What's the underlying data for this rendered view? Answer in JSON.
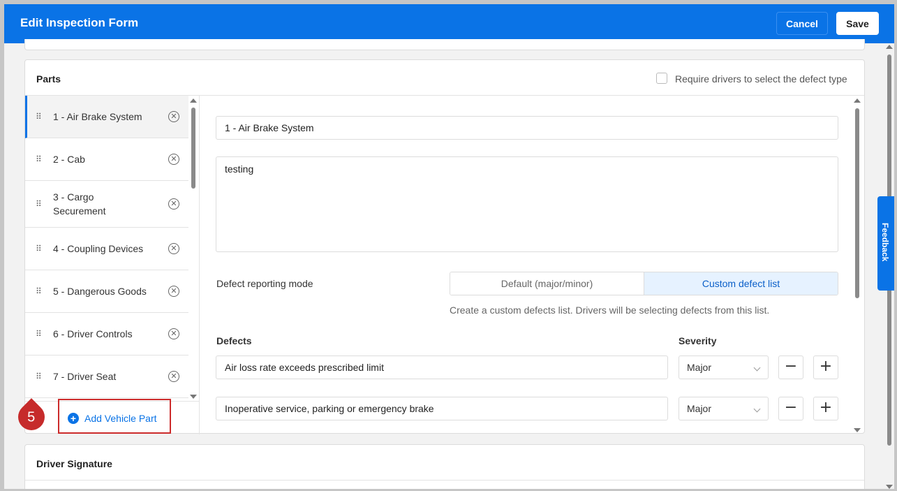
{
  "header": {
    "title": "Edit Inspection Form",
    "cancel_label": "Cancel",
    "save_label": "Save"
  },
  "parts": {
    "title": "Parts",
    "require_defect_type_label": "Require drivers to select the defect type",
    "require_defect_type_checked": false,
    "items": [
      {
        "label": "1 - Air Brake System"
      },
      {
        "label": "2 - Cab"
      },
      {
        "label": "3 - Cargo Securement"
      },
      {
        "label": "4 - Coupling Devices"
      },
      {
        "label": "5 - Dangerous Goods"
      },
      {
        "label": "6 - Driver Controls"
      },
      {
        "label": "7 - Driver Seat"
      }
    ],
    "add_label": "Add Vehicle Part"
  },
  "detail": {
    "name_value": "1 - Air Brake System",
    "description_value": "testing",
    "mode_label": "Defect reporting mode",
    "mode_options": [
      "Default (major/minor)",
      "Custom defect list"
    ],
    "mode_selected": "Custom defect list",
    "mode_hint": "Create a custom defects list. Drivers will be selecting defects from this list.",
    "defects_header": "Defects",
    "severity_header": "Severity",
    "defects": [
      {
        "text": "Air loss rate exceeds prescribed limit",
        "severity": "Major"
      },
      {
        "text": "Inoperative service, parking or emergency brake",
        "severity": "Major"
      }
    ]
  },
  "signature": {
    "title": "Driver Signature"
  },
  "feedback_label": "Feedback",
  "annotation": {
    "step": "5"
  },
  "icons": {
    "drag": "drag-handle-icon",
    "remove": "remove-circle-icon",
    "add": "plus-circle-icon",
    "chevron": "chevron-down-icon"
  },
  "colors": {
    "primary": "#0a73e6",
    "annotation": "#c62b2b",
    "selected_bg": "#e6f2ff"
  }
}
